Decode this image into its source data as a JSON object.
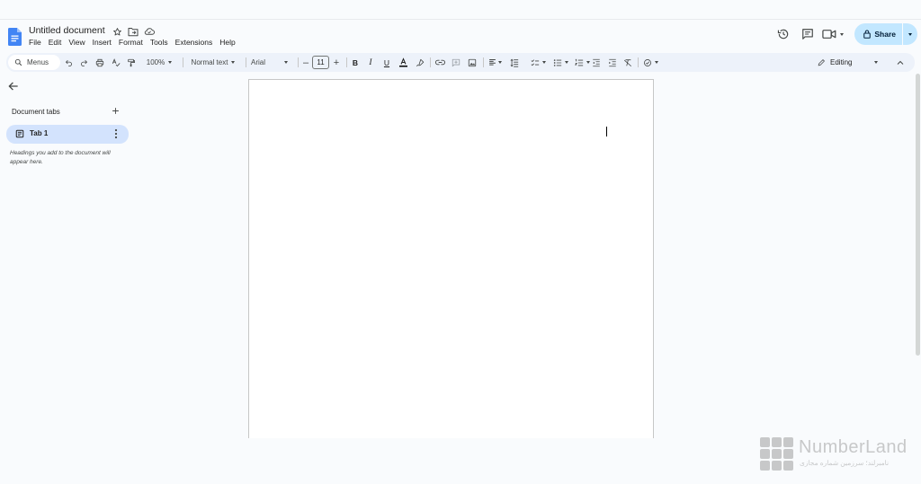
{
  "document": {
    "title": "Untitled document"
  },
  "menu": [
    "File",
    "Edit",
    "View",
    "Insert",
    "Format",
    "Tools",
    "Extensions",
    "Help"
  ],
  "header_right": {
    "share_label": "Share"
  },
  "toolbar": {
    "search_label": "Menus",
    "zoom": "100%",
    "style": "Normal text",
    "font": "Arial",
    "font_size": "11",
    "mode": "Editing"
  },
  "sidebar": {
    "heading": "Document tabs",
    "tab_label": "Tab 1",
    "hint": "Headings you add to the document will appear here."
  },
  "watermark": {
    "name": "NumberLand",
    "subtitle": "نامبرلند؛ سرزمین شماره مجازی"
  },
  "colors": {
    "accent": "#1a73e8",
    "share_bg": "#c2e7ff",
    "toolbar_bg": "#edf2fa",
    "tab_selected_bg": "#d3e3fd",
    "page_bg": "#f9fbfd"
  },
  "icons": {
    "header": [
      "star-icon",
      "move-to-folder-icon",
      "cloud-saved-icon",
      "version-history-icon",
      "comments-icon",
      "meet-icon",
      "lock-icon"
    ],
    "toolbar": [
      "search-icon",
      "undo-icon",
      "redo-icon",
      "print-icon",
      "spellcheck-icon",
      "paint-format-icon",
      "bold-icon",
      "italic-icon",
      "underline-icon",
      "text-color-icon",
      "highlight-icon",
      "link-icon",
      "add-comment-icon",
      "insert-image-icon",
      "align-icon",
      "line-spacing-icon",
      "checklist-icon",
      "bulleted-list-icon",
      "numbered-list-icon",
      "decrease-indent-icon",
      "increase-indent-icon",
      "clear-formatting-icon",
      "editing-pencil-icon"
    ]
  }
}
